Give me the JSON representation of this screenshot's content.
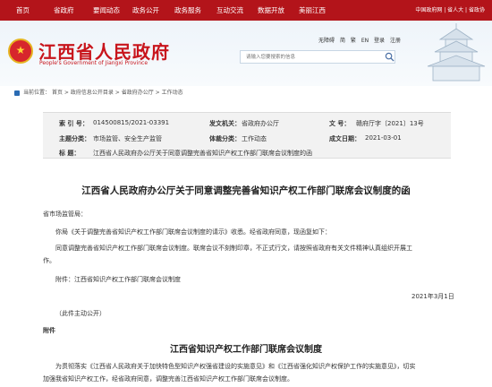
{
  "nav": {
    "items": [
      "首页",
      "省政府",
      "要闻动态",
      "政务公开",
      "政务服务",
      "互动交流",
      "数据开放",
      "美丽江西"
    ],
    "right_links": "中国政府网 | 省人大 | 省政协"
  },
  "header": {
    "title": "江西省人民政府",
    "subtitle": "People's Government of Jiangxi Province",
    "links": [
      "无障碍",
      "简",
      "繁",
      "EN",
      "登录",
      "注册"
    ],
    "search_placeholder": "请输入您要搜索的信息"
  },
  "breadcrumb": {
    "label": "当前位置：",
    "items": [
      "首页",
      "政府信息公开目录",
      "省政府办公厅",
      "工作动态"
    ],
    "sep": ">"
  },
  "meta": {
    "index_label": "索 引 号：",
    "index_value": "014500815/2021-03391",
    "org_label": "发文机关：",
    "org_value": "省政府办公厅",
    "doc_no_label": "文 号：",
    "doc_no_value": "赣府厅字〔2021〕13号",
    "subject_label": "主题分类：",
    "subject_value": "市场监管、安全生产监管",
    "genre_label": "体裁分类：",
    "genre_value": "工作动态",
    "date_label": "成文日期：",
    "date_value": "2021-03-01",
    "title_label": "标 题：",
    "title_value": "江西省人民政府办公厅关于同意调整完善省知识产权工作部门联席会议制度的函"
  },
  "doc": {
    "title": "江西省人民政府办公厅关于同意调整完善省知识产权工作部门联席会议制度的函",
    "addressee": "省市场监管局：",
    "p1": "你局《关于调整完善省知识产权工作部门联席会议制度的请示》收悉。经省政府同意，现函复如下：",
    "p2a": "同意调整完善省知识产权工作部门联席会议制度。联席会议不刻制印章，不正式行文，请按照省政府有关文件精神认真组织开展工",
    "p2b": "作。",
    "attachment": "附件：江西省知识产权工作部门联席会议制度",
    "date": "2021年3月1日",
    "note": "（此件主动公开）",
    "appendix_label": "附件",
    "appendix_title": "江西省知识产权工作部门联席会议制度",
    "p3a": "为贯彻落实《江西省人民政府关于加快特色型知识产权强省建设的实施意见》和《江西省强化知识产权保护工作的实施意见》，切实",
    "p3b": "加强我省知识产权工作，经省政府同意，调整完善江西省知识产权工作部门联席会议制度。"
  }
}
